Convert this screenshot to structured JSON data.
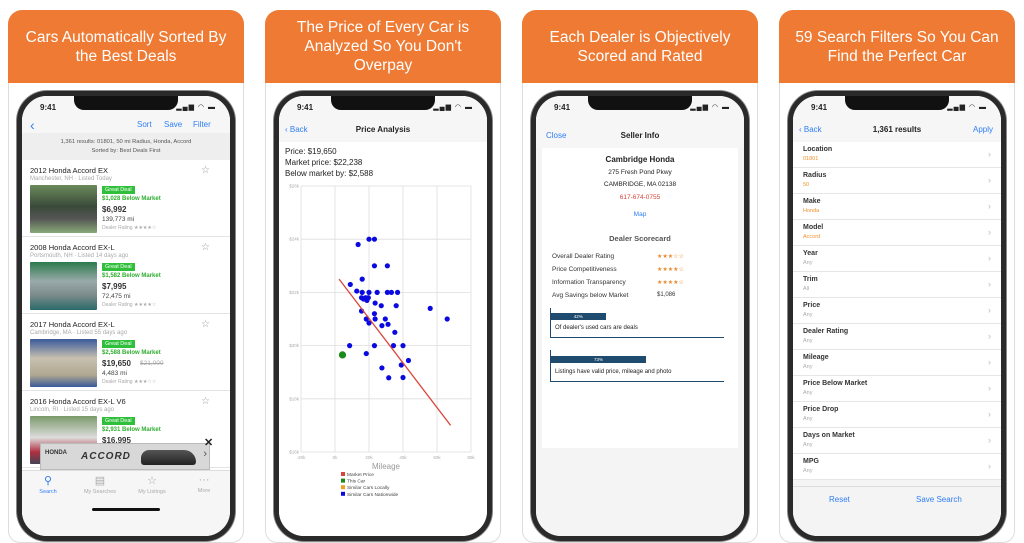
{
  "colors": {
    "header": "#ee7a33",
    "link": "#2f7ef5",
    "deal": "#2fbf3a",
    "filter_value": "#f0922e",
    "market_line": "#d9443a",
    "this_car": "#1a8a1a",
    "nationwide": "#0a0ae0",
    "local": "#f0a020",
    "bar": "#1e4b6e"
  },
  "panels": [
    {
      "headline": "Cars Automatically Sorted By the Best Deals"
    },
    {
      "headline": "The Price of Every Car is Analyzed So You Don't Overpay"
    },
    {
      "headline": "Each Dealer is Objectively Scored and Rated"
    },
    {
      "headline": "59 Search Filters So You Can Find the Perfect Car"
    }
  ],
  "status": {
    "time": "9:41",
    "icons": "signal-wifi-battery"
  },
  "results": {
    "nav": {
      "back": "‹",
      "sort": "Sort",
      "save": "Save",
      "filter": "Filter"
    },
    "summary_line1": "1,361 results: 01801, 50 mi Radius, Honda, Accord",
    "summary_line2": "Sorted by: Best Deals First",
    "listings": [
      {
        "title": "2012 Honda Accord EX",
        "location": "Manchester, NH  ·  Listed Today",
        "badge": "Great Deal",
        "below": "$1,028 Below Market",
        "price": "$6,992",
        "old_price": "",
        "mileage": "139,773 mi",
        "dealer_rating": "Dealer Rating ★★★★☆"
      },
      {
        "title": "2008 Honda Accord EX-L",
        "location": "Portsmouth, NH  ·  Listed 14 days ago",
        "badge": "Great Deal",
        "below": "$1,582 Below Market",
        "price": "$7,995",
        "old_price": "",
        "mileage": "72,475 mi",
        "dealer_rating": "Dealer Rating ★★★★☆"
      },
      {
        "title": "2017 Honda Accord EX-L",
        "location": "Cambridge, MA  ·  Listed 55 days ago",
        "badge": "Great Deal",
        "below": "$2,588 Below Market",
        "price": "$19,650",
        "old_price": "$21,000",
        "mileage": "4,483 mi",
        "dealer_rating": "Dealer Rating ★★★☆☆"
      },
      {
        "title": "2016 Honda Accord EX-L V6",
        "location": "Lincoln, RI  ·  Listed 15 days ago",
        "badge": "Great Deal",
        "below": "$2,931 Below Market",
        "price": "$16,995",
        "old_price": "",
        "mileage": "",
        "dealer_rating": ""
      }
    ],
    "ad": {
      "brand": "HONDA",
      "model": "ACCORD",
      "close": "✕",
      "next": "›"
    },
    "tabs": [
      {
        "label": "Search",
        "icon": "search-icon"
      },
      {
        "label": "My Searches",
        "icon": "clipboard-icon"
      },
      {
        "label": "My Listings",
        "icon": "star-icon"
      },
      {
        "label": "More",
        "icon": "more-icon"
      }
    ]
  },
  "analysis": {
    "nav": {
      "back": "‹ Back",
      "title": "Price Analysis"
    },
    "price": "Price: $19,650",
    "market": "Market price: $22,238",
    "below": "Below market by: $2,588"
  },
  "chart_data": {
    "type": "scatter",
    "xlabel": "Mileage",
    "ylabel": "",
    "xlim": [
      -20000,
      80000
    ],
    "ylim": [
      16000,
      26000
    ],
    "x_ticks": [
      "-20k",
      "0k",
      "20k",
      "40k",
      "60k",
      "80k"
    ],
    "y_ticks": [
      "$26k",
      "$24k",
      "$22k",
      "$20k",
      "$18k",
      "$16k"
    ],
    "grid": true,
    "legend_position": "bottom",
    "legend": [
      "Market Price",
      "This Car",
      "Similar Cars Locally",
      "Similar Cars Nationwide"
    ],
    "series": [
      {
        "name": "Market Price",
        "type": "line",
        "points": [
          [
            2400,
            22500
          ],
          [
            68000,
            17000
          ]
        ]
      },
      {
        "name": "This Car",
        "points": [
          [
            4400,
            19650
          ]
        ]
      },
      {
        "name": "Similar Cars Locally",
        "points": []
      },
      {
        "name": "Similar Cars Nationwide",
        "points": [
          [
            13600,
            23800
          ],
          [
            20000,
            24000
          ],
          [
            23200,
            24000
          ],
          [
            23200,
            23000
          ],
          [
            30800,
            23000
          ],
          [
            16000,
            22500
          ],
          [
            9000,
            22300
          ],
          [
            12800,
            22050
          ],
          [
            16000,
            22000
          ],
          [
            20000,
            22000
          ],
          [
            24800,
            22000
          ],
          [
            30800,
            22000
          ],
          [
            33200,
            22000
          ],
          [
            36800,
            22000
          ],
          [
            15600,
            21800
          ],
          [
            18000,
            21800
          ],
          [
            19600,
            21800
          ],
          [
            16800,
            21750
          ],
          [
            18800,
            21700
          ],
          [
            23600,
            21600
          ],
          [
            27200,
            21500
          ],
          [
            36000,
            21500
          ],
          [
            56000,
            21400
          ],
          [
            15600,
            21300
          ],
          [
            23200,
            21200
          ],
          [
            18400,
            21000
          ],
          [
            20000,
            20850
          ],
          [
            23600,
            21000
          ],
          [
            29600,
            21000
          ],
          [
            31200,
            20800
          ],
          [
            27600,
            20750
          ],
          [
            66000,
            21000
          ],
          [
            35200,
            20500
          ],
          [
            8600,
            20000
          ],
          [
            23200,
            20000
          ],
          [
            34400,
            20000
          ],
          [
            40000,
            20000
          ],
          [
            18400,
            19700
          ],
          [
            39000,
            19270
          ],
          [
            43200,
            19440
          ],
          [
            27600,
            19160
          ],
          [
            31600,
            18790
          ],
          [
            40000,
            18800
          ]
        ]
      }
    ]
  },
  "seller": {
    "nav": {
      "close": "Close",
      "title": "Seller Info"
    },
    "name": "Cambridge Honda",
    "address": "275 Fresh Pond Pkwy",
    "city": "CAMBRIDGE, MA 02138",
    "phone": "617-674-0755",
    "map": "Map",
    "scorecard_title": "Dealer Scorecard",
    "rows": [
      {
        "label": "Overall Dealer Rating",
        "value": "★★★☆☆",
        "stars": 3
      },
      {
        "label": "Price Competitiveness",
        "value": "★★★★☆",
        "stars": 4
      },
      {
        "label": "Information Transparency",
        "value": "★★★★☆",
        "stars": 4
      },
      {
        "label": "Avg Savings below Market",
        "value": "$1,086"
      }
    ],
    "bars": [
      {
        "value": 42,
        "label_pct": "42%",
        "text": "Of dealer's used cars are deals"
      },
      {
        "value": 73,
        "label_pct": "73%",
        "text": "Listings have valid price, mileage and photo"
      }
    ]
  },
  "filters": {
    "nav": {
      "back": "‹ Back",
      "title": "1,361 results",
      "apply": "Apply"
    },
    "rows": [
      {
        "label": "Location",
        "value": "01801",
        "set": true
      },
      {
        "label": "Radius",
        "value": "50",
        "set": true
      },
      {
        "label": "Make",
        "value": "Honda",
        "set": true
      },
      {
        "label": "Model",
        "value": "Accord",
        "set": true
      },
      {
        "label": "Year",
        "value": "Any",
        "set": false
      },
      {
        "label": "Trim",
        "value": "All",
        "set": false
      },
      {
        "label": "Price",
        "value": "Any",
        "set": false
      },
      {
        "label": "Dealer Rating",
        "value": "Any",
        "set": false
      },
      {
        "label": "Mileage",
        "value": "Any",
        "set": false
      },
      {
        "label": "Price Below Market",
        "value": "Any",
        "set": false
      },
      {
        "label": "Price Drop",
        "value": "Any",
        "set": false
      },
      {
        "label": "Days on Market",
        "value": "Any",
        "set": false
      },
      {
        "label": "MPG",
        "value": "Any",
        "set": false
      }
    ],
    "reset": "Reset",
    "save_search": "Save Search"
  }
}
